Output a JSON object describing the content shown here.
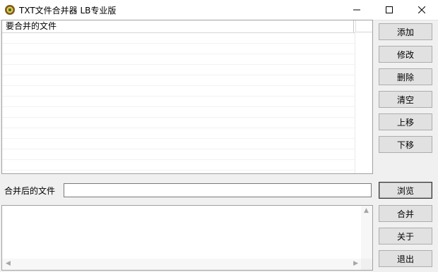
{
  "window": {
    "title": "TXT文件合并器 LB专业版"
  },
  "file_list": {
    "column_header": "要合并的文件",
    "rows": []
  },
  "buttons": {
    "add": "添加",
    "modify": "修改",
    "delete": "删除",
    "clear": "清空",
    "move_up": "上移",
    "move_down": "下移",
    "browse": "浏览",
    "merge": "合并",
    "about": "关于",
    "exit": "退出"
  },
  "merged_file": {
    "label": "合并后的文件",
    "value": ""
  },
  "log": {
    "text": ""
  },
  "icons": [
    "app-icon",
    "minimize-icon",
    "maximize-icon",
    "close-icon",
    "scroll-up-arrow-icon",
    "scroll-left-arrow-icon",
    "scroll-right-arrow-icon"
  ]
}
